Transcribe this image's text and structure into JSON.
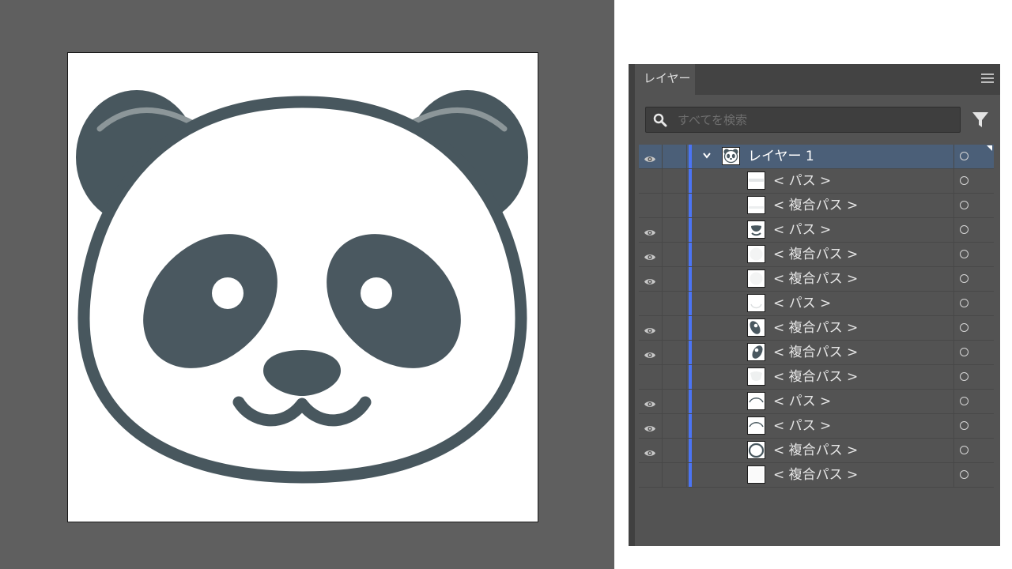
{
  "colors": {
    "canvas_bg": "#5f5f5f",
    "panda_dark": "#48575e",
    "panda_patch": "#4a5860",
    "ear_highlight": "#8c9699",
    "panel_bg": "#535353",
    "selected_row": "#4b5f78",
    "layer_color_bar": "#4b74f4"
  },
  "artboard": {
    "description": "panda face illustration"
  },
  "layers_panel": {
    "tab_label": "レイヤー",
    "menu_icon": "hamburger-menu-icon",
    "search": {
      "placeholder": "すべてを検索",
      "value": ""
    },
    "filter_icon": "filter-icon",
    "layers": [
      {
        "name": "レイヤー 1",
        "visible": true,
        "selected": true,
        "expanded": true,
        "level": 0,
        "thumb": "panda"
      },
      {
        "name": "< パス >",
        "visible": false,
        "level": 1,
        "thumb": "band-top"
      },
      {
        "name": "< 複合パス >",
        "visible": false,
        "level": 1,
        "thumb": "band-mid"
      },
      {
        "name": "< パス >",
        "visible": true,
        "level": 1,
        "thumb": "nose"
      },
      {
        "name": "< 複合パス >",
        "visible": true,
        "level": 1,
        "thumb": "faint-circle"
      },
      {
        "name": "< 複合パス >",
        "visible": true,
        "level": 1,
        "thumb": "faint-circle"
      },
      {
        "name": "< パス >",
        "visible": false,
        "level": 1,
        "thumb": "arc-bottom"
      },
      {
        "name": "< 複合パス >",
        "visible": true,
        "level": 1,
        "thumb": "eye-left"
      },
      {
        "name": "< 複合パス >",
        "visible": true,
        "level": 1,
        "thumb": "eye-right"
      },
      {
        "name": "< 複合パス >",
        "visible": false,
        "level": 1,
        "thumb": "faint-shape"
      },
      {
        "name": "< パス >",
        "visible": true,
        "level": 1,
        "thumb": "arc-top"
      },
      {
        "name": "< パス >",
        "visible": true,
        "level": 1,
        "thumb": "arc-top"
      },
      {
        "name": "< 複合パス >",
        "visible": true,
        "level": 1,
        "thumb": "ring"
      },
      {
        "name": "< 複合パス >",
        "visible": false,
        "level": 1,
        "thumb": "blank"
      }
    ]
  }
}
